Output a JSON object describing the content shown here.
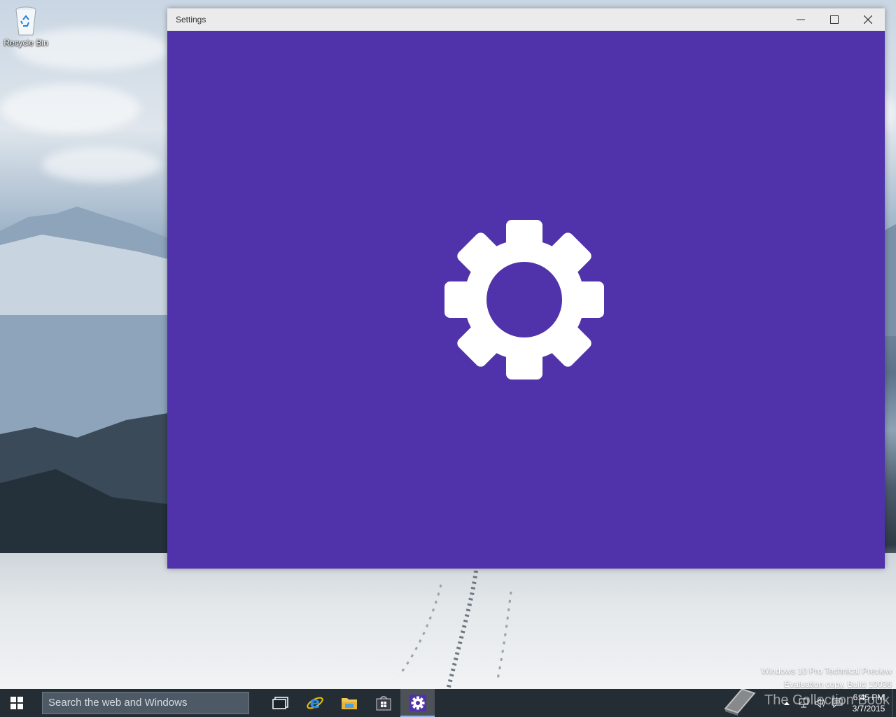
{
  "desktop": {
    "icons": [
      {
        "label": "Recycle Bin",
        "icon": "recycle-bin-icon"
      }
    ]
  },
  "window": {
    "title": "Settings",
    "controls": [
      "minimize-icon",
      "maximize-icon",
      "close-icon"
    ],
    "splash_color": "#5033aa",
    "splash_icon": "gear-icon"
  },
  "watermark": {
    "line1": "Windows 10 Pro Technical Preview",
    "line2": "Evaluation copy. Build 10036"
  },
  "overlay": {
    "text": "The Collection Book"
  },
  "taskbar": {
    "search_placeholder": "Search the web and Windows",
    "apps": [
      "task-view-icon",
      "internet-explorer-icon",
      "file-explorer-icon",
      "store-icon",
      "settings-icon"
    ],
    "active_app": "settings-icon",
    "clock": {
      "time": "6:45 PM",
      "date": "3/7/2015"
    }
  }
}
